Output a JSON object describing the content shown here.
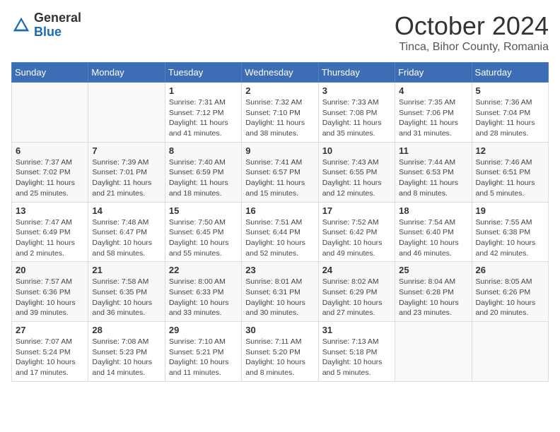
{
  "header": {
    "logo_general": "General",
    "logo_blue": "Blue",
    "month_title": "October 2024",
    "location": "Tinca, Bihor County, Romania"
  },
  "weekdays": [
    "Sunday",
    "Monday",
    "Tuesday",
    "Wednesday",
    "Thursday",
    "Friday",
    "Saturday"
  ],
  "weeks": [
    [
      {
        "day": "",
        "info": ""
      },
      {
        "day": "",
        "info": ""
      },
      {
        "day": "1",
        "info": "Sunrise: 7:31 AM\nSunset: 7:12 PM\nDaylight: 11 hours and 41 minutes."
      },
      {
        "day": "2",
        "info": "Sunrise: 7:32 AM\nSunset: 7:10 PM\nDaylight: 11 hours and 38 minutes."
      },
      {
        "day": "3",
        "info": "Sunrise: 7:33 AM\nSunset: 7:08 PM\nDaylight: 11 hours and 35 minutes."
      },
      {
        "day": "4",
        "info": "Sunrise: 7:35 AM\nSunset: 7:06 PM\nDaylight: 11 hours and 31 minutes."
      },
      {
        "day": "5",
        "info": "Sunrise: 7:36 AM\nSunset: 7:04 PM\nDaylight: 11 hours and 28 minutes."
      }
    ],
    [
      {
        "day": "6",
        "info": "Sunrise: 7:37 AM\nSunset: 7:02 PM\nDaylight: 11 hours and 25 minutes."
      },
      {
        "day": "7",
        "info": "Sunrise: 7:39 AM\nSunset: 7:01 PM\nDaylight: 11 hours and 21 minutes."
      },
      {
        "day": "8",
        "info": "Sunrise: 7:40 AM\nSunset: 6:59 PM\nDaylight: 11 hours and 18 minutes."
      },
      {
        "day": "9",
        "info": "Sunrise: 7:41 AM\nSunset: 6:57 PM\nDaylight: 11 hours and 15 minutes."
      },
      {
        "day": "10",
        "info": "Sunrise: 7:43 AM\nSunset: 6:55 PM\nDaylight: 11 hours and 12 minutes."
      },
      {
        "day": "11",
        "info": "Sunrise: 7:44 AM\nSunset: 6:53 PM\nDaylight: 11 hours and 8 minutes."
      },
      {
        "day": "12",
        "info": "Sunrise: 7:46 AM\nSunset: 6:51 PM\nDaylight: 11 hours and 5 minutes."
      }
    ],
    [
      {
        "day": "13",
        "info": "Sunrise: 7:47 AM\nSunset: 6:49 PM\nDaylight: 11 hours and 2 minutes."
      },
      {
        "day": "14",
        "info": "Sunrise: 7:48 AM\nSunset: 6:47 PM\nDaylight: 10 hours and 58 minutes."
      },
      {
        "day": "15",
        "info": "Sunrise: 7:50 AM\nSunset: 6:45 PM\nDaylight: 10 hours and 55 minutes."
      },
      {
        "day": "16",
        "info": "Sunrise: 7:51 AM\nSunset: 6:44 PM\nDaylight: 10 hours and 52 minutes."
      },
      {
        "day": "17",
        "info": "Sunrise: 7:52 AM\nSunset: 6:42 PM\nDaylight: 10 hours and 49 minutes."
      },
      {
        "day": "18",
        "info": "Sunrise: 7:54 AM\nSunset: 6:40 PM\nDaylight: 10 hours and 46 minutes."
      },
      {
        "day": "19",
        "info": "Sunrise: 7:55 AM\nSunset: 6:38 PM\nDaylight: 10 hours and 42 minutes."
      }
    ],
    [
      {
        "day": "20",
        "info": "Sunrise: 7:57 AM\nSunset: 6:36 PM\nDaylight: 10 hours and 39 minutes."
      },
      {
        "day": "21",
        "info": "Sunrise: 7:58 AM\nSunset: 6:35 PM\nDaylight: 10 hours and 36 minutes."
      },
      {
        "day": "22",
        "info": "Sunrise: 8:00 AM\nSunset: 6:33 PM\nDaylight: 10 hours and 33 minutes."
      },
      {
        "day": "23",
        "info": "Sunrise: 8:01 AM\nSunset: 6:31 PM\nDaylight: 10 hours and 30 minutes."
      },
      {
        "day": "24",
        "info": "Sunrise: 8:02 AM\nSunset: 6:29 PM\nDaylight: 10 hours and 27 minutes."
      },
      {
        "day": "25",
        "info": "Sunrise: 8:04 AM\nSunset: 6:28 PM\nDaylight: 10 hours and 23 minutes."
      },
      {
        "day": "26",
        "info": "Sunrise: 8:05 AM\nSunset: 6:26 PM\nDaylight: 10 hours and 20 minutes."
      }
    ],
    [
      {
        "day": "27",
        "info": "Sunrise: 7:07 AM\nSunset: 5:24 PM\nDaylight: 10 hours and 17 minutes."
      },
      {
        "day": "28",
        "info": "Sunrise: 7:08 AM\nSunset: 5:23 PM\nDaylight: 10 hours and 14 minutes."
      },
      {
        "day": "29",
        "info": "Sunrise: 7:10 AM\nSunset: 5:21 PM\nDaylight: 10 hours and 11 minutes."
      },
      {
        "day": "30",
        "info": "Sunrise: 7:11 AM\nSunset: 5:20 PM\nDaylight: 10 hours and 8 minutes."
      },
      {
        "day": "31",
        "info": "Sunrise: 7:13 AM\nSunset: 5:18 PM\nDaylight: 10 hours and 5 minutes."
      },
      {
        "day": "",
        "info": ""
      },
      {
        "day": "",
        "info": ""
      }
    ]
  ]
}
